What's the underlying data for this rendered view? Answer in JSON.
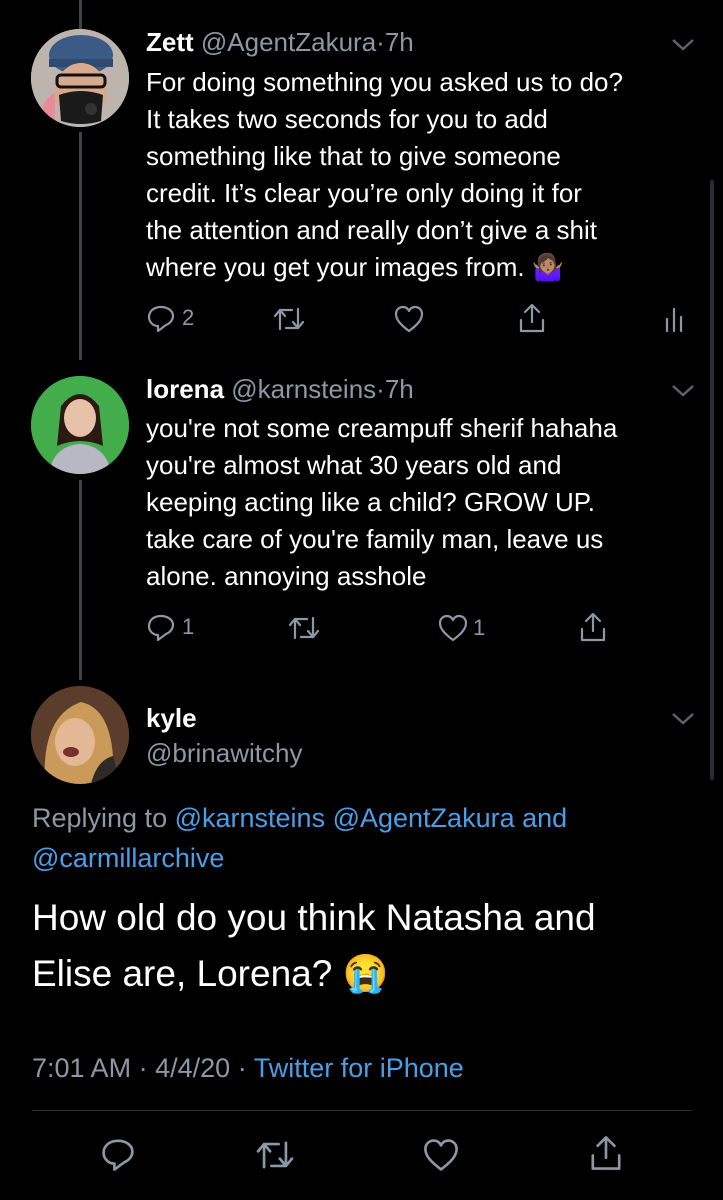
{
  "tweets": [
    {
      "display_name": "Zett",
      "handle": "@AgentZakura",
      "separator": "·",
      "time": "7h",
      "lines": [
        "For doing something you asked us to do?",
        "It takes two seconds for you to add",
        "something like that to give someone",
        "credit. It’s clear you’re only doing it for",
        "the attention and really don’t give a shit",
        "where you get your images from."
      ],
      "emoji": "🤷🏽‍♀️",
      "reply_count": "2",
      "retweet_count": "",
      "like_count": ""
    },
    {
      "display_name": "lorena",
      "handle": "@karnsteins",
      "separator": "·",
      "time": "7h",
      "lines": [
        "you're not some creampuff sherif hahaha",
        "you're almost what 30 years old and",
        "keeping acting like a child? GROW UP.",
        "take care of you're family man, leave us",
        "alone. annoying asshole"
      ],
      "reply_count": "1",
      "retweet_count": "",
      "like_count": "1"
    }
  ],
  "main": {
    "display_name": "kyle",
    "handle": "@brinawitchy",
    "replying_prefix": "Replying to",
    "reply_handle_1": "@karnsteins",
    "reply_handle_2": "@AgentZakura",
    "reply_and": "and",
    "reply_handle_3": "@carmillarchive",
    "text_line_1": "How old do you think Natasha and",
    "text_line_2": "Elise are, Lorena?",
    "emoji": "😭",
    "time": "7:01 AM",
    "sep1": "·",
    "date": "4/4/20",
    "sep2": "·",
    "source": "Twitter for iPhone"
  },
  "icons": [
    "reply-icon",
    "retweet-icon",
    "like-icon",
    "share-icon",
    "analytics-icon",
    "chevron-down-icon"
  ],
  "colors": {
    "background": "#000000",
    "text": "#ffffff",
    "muted": "#8b98a5",
    "link": "#4a9fe8",
    "thread_line": "#3d4348"
  }
}
